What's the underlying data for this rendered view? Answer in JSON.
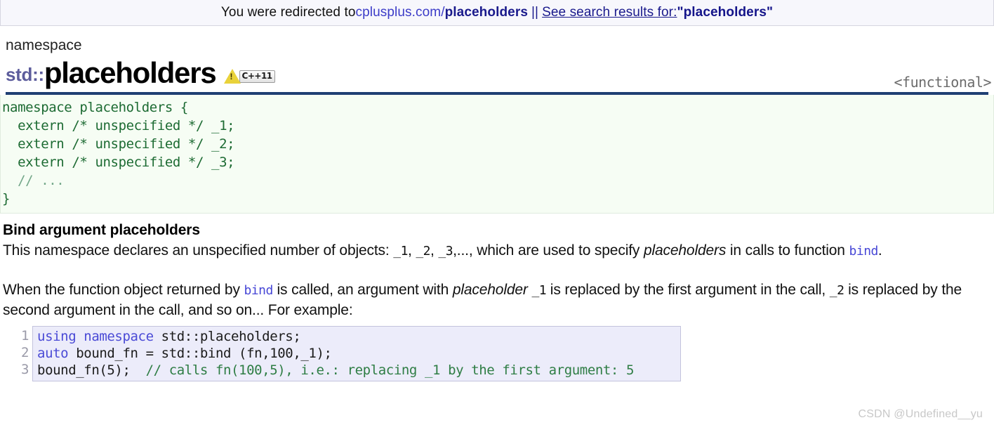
{
  "redirect_banner": {
    "prefix": "You were redirected to ",
    "domain": "cplusplus.com",
    "slash": "/",
    "path": "placeholders",
    "separator": "||",
    "see_text": " See search results for: ",
    "query": "\"placeholders\""
  },
  "page_header": {
    "kind": "namespace",
    "namespace_prefix": "std::",
    "name": "placeholders",
    "warning_icon": "warning-triangle-icon",
    "std_badge": "C++11",
    "header_file": "<functional>"
  },
  "declaration": {
    "lines": [
      "namespace placeholders {",
      "  extern /* unspecified */ _1;",
      "  extern /* unspecified */ _2;",
      "  extern /* unspecified */ _3;",
      "  // ...",
      "}"
    ],
    "line1": "namespace placeholders {",
    "line2": "  extern /* unspecified */ _1;",
    "line3": "  extern /* unspecified */ _2;",
    "line4": "  extern /* unspecified */ _3;",
    "line5": "  // ...",
    "line6": "}"
  },
  "section": {
    "heading": "Bind argument placeholders",
    "paragraph1": {
      "t1": "This namespace declares an unspecified number of objects: ",
      "c1": "_1",
      "t2": ", ",
      "c2": "_2",
      "t3": ", ",
      "c3": "_3",
      "t4": ",..., which are used to specify ",
      "i1": "placeholders",
      "t5": " in calls to function ",
      "link": "bind",
      "t6": "."
    },
    "paragraph2": {
      "t1": "When the function object returned by ",
      "link": "bind",
      "t2": " is called, an argument with ",
      "i1": "placeholder",
      "t3": " ",
      "c1": "_1",
      "t4": " is replaced by the first argument in the call, ",
      "c2": "_2",
      "t5": " is replaced by the second argument in the call, and so on... For example:"
    }
  },
  "example_code": {
    "line_numbers": "1\n2\n3",
    "ln1": "1",
    "ln2": "2",
    "ln3": "3",
    "l1_kw": "using namespace",
    "l1_rest": " std::placeholders;",
    "l2_kw": "auto",
    "l2_rest": " bound_fn = std::bind (fn,100,_1);",
    "l3_code": "bound_fn(5);  ",
    "l3_comment": "// calls fn(100,5), i.e.: replacing _1 by the first argument: 5"
  },
  "watermark": "CSDN @Undefined__yu",
  "colors": {
    "banner_bg": "#f7f7fc",
    "link": "#3c3cc8",
    "link_bold": "#1a1a8c",
    "namespace_prefix": "#5c5c9c",
    "title_rule": "#1f3f73",
    "decl_bg": "#f6fdf4",
    "decl_text": "#1d6b33",
    "example_bg": "#ececfa",
    "keyword": "#4a4ad6",
    "comment": "#2e7d44",
    "badge_yellow": "#e9d23a"
  }
}
